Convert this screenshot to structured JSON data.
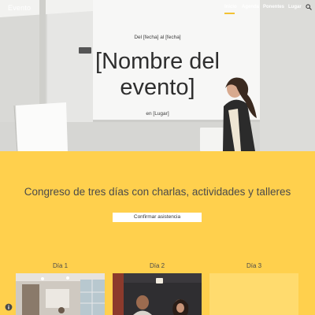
{
  "site": {
    "title": "Evento"
  },
  "nav": {
    "items": [
      {
        "label": "Inicio",
        "active": true
      },
      {
        "label": "Agenda",
        "active": false
      },
      {
        "label": "Ponentes",
        "active": false
      },
      {
        "label": "Lugar",
        "active": false
      }
    ],
    "search_icon": "search-icon"
  },
  "hero": {
    "date_line": "Del [fecha] al [fecha]",
    "title_line1": "[Nombre del",
    "title_line2": "evento]",
    "place_line": "en [Lugar]"
  },
  "section": {
    "tagline": "Congreso de tres días con charlas, actividades y talleres",
    "cta_label": "Confirmar asistencia"
  },
  "days": [
    {
      "label": "Día 1"
    },
    {
      "label": "Día 2"
    },
    {
      "label": "Día 3"
    }
  ],
  "colors": {
    "accent": "#ffd04d",
    "nav_underline": "#f2c233",
    "day3_card": "#ffdb6e"
  },
  "footer": {
    "settings_icon": "info-icon"
  }
}
